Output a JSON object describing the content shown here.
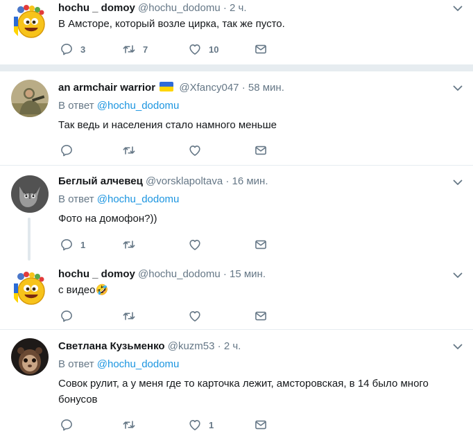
{
  "tweets": [
    {
      "name": "hochu _ domoy",
      "handle": "@hochu_dodomu",
      "time": "2 ч.",
      "text": "В Амсторе, который возле цирка, так же пусто.",
      "reply_count": "3",
      "retweet_count": "7",
      "like_count": "10"
    },
    {
      "name": "an armchair warrior",
      "flag": "ukraine-flag",
      "handle": "@Xfancy047",
      "time": "58 мин.",
      "reply_prefix": "В ответ",
      "reply_to": "@hochu_dodomu",
      "text": "Так ведь и населения стало намного меньше"
    },
    {
      "name": "Беглый алчевец",
      "handle": "@vorsklapoltava",
      "time": "16 мин.",
      "reply_prefix": "В ответ",
      "reply_to": "@hochu_dodomu",
      "text": "Фото на домофон?))",
      "reply_count": "1"
    },
    {
      "name": "hochu _ domoy",
      "handle": "@hochu_dodomu",
      "time": "15 мин.",
      "text": "с видео🤣"
    },
    {
      "name": "Светлана Кузьменко",
      "handle": "@kuzm53",
      "time": "2 ч.",
      "reply_prefix": "В ответ",
      "reply_to": "@hochu_dodomu",
      "text": "Совок рулит, а у меня где то карточка лежит, амсторовская, в 14 было много бонусов",
      "like_count": "1"
    }
  ],
  "dot": "·",
  "icons": [
    "reply-icon",
    "retweet-icon",
    "heart-icon",
    "envelope-icon",
    "chevron-down-icon"
  ],
  "colors": {
    "text": "#14171a",
    "secondary": "#657786",
    "link": "#1b95e0",
    "divider": "#e6ecf0"
  }
}
